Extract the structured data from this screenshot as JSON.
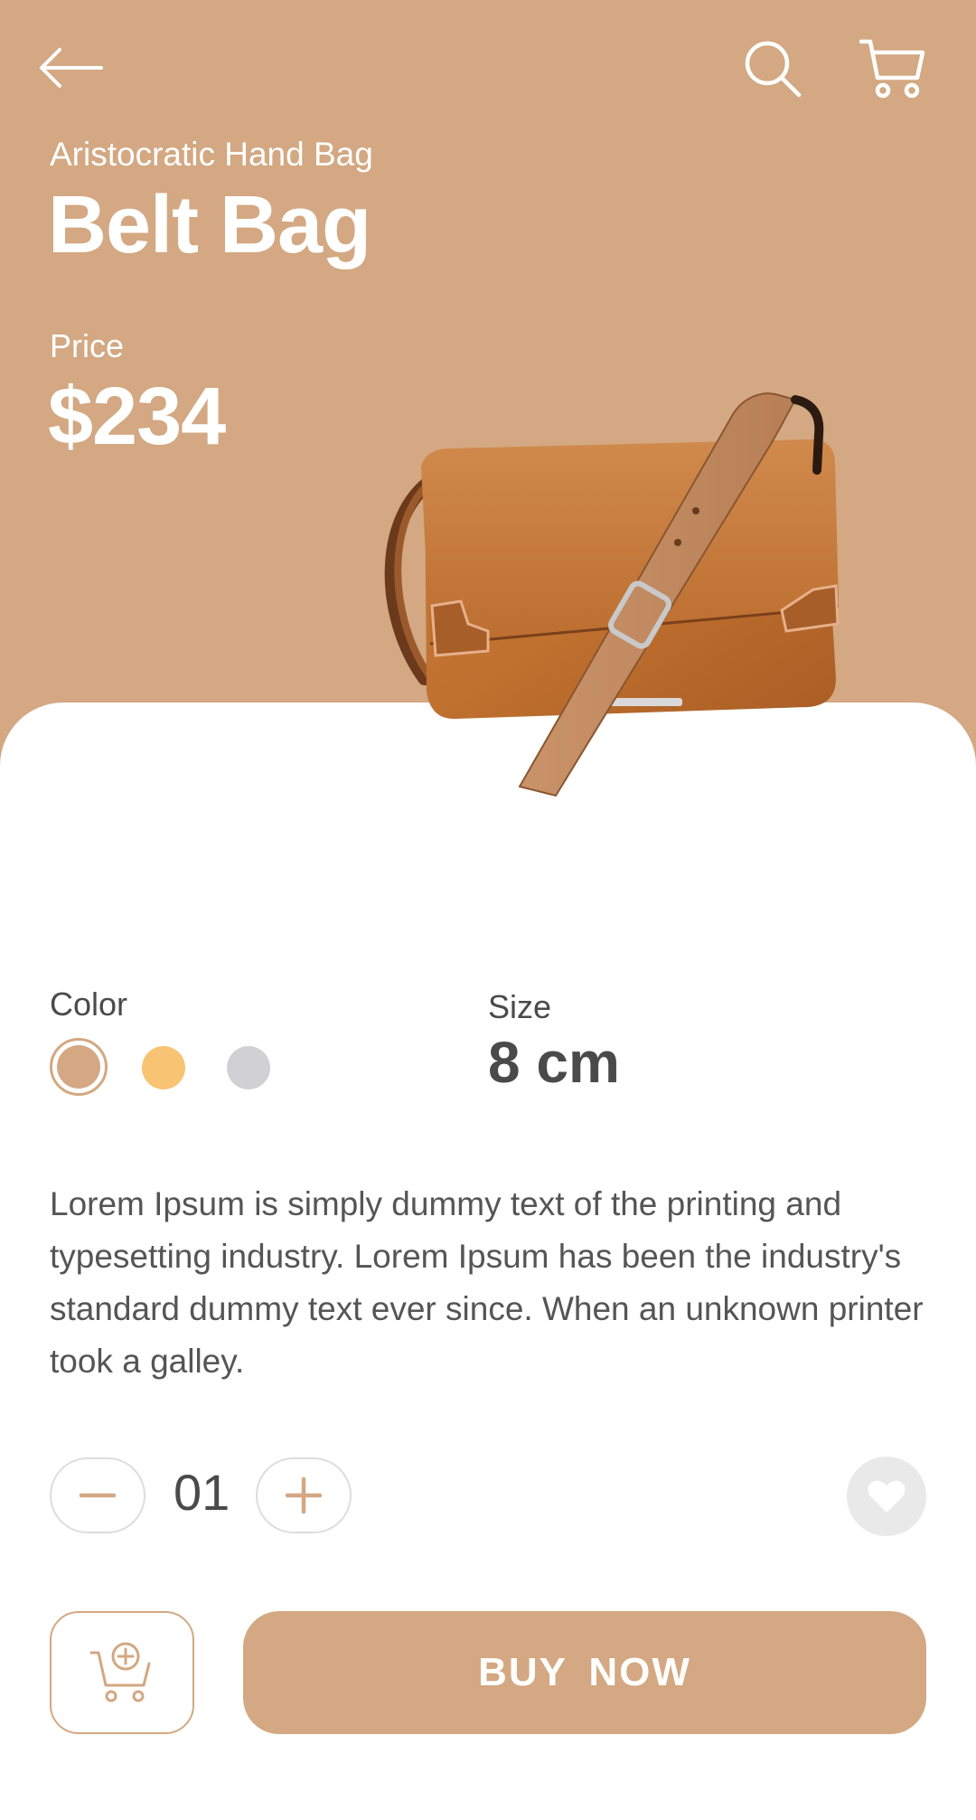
{
  "colors": {
    "hero_bg": "#D3A882",
    "accent": "#D3A882",
    "swatches": [
      "#D3A882",
      "#F8C373",
      "#D1D1D3"
    ]
  },
  "header": {
    "back_icon": "arrow-left-icon",
    "search_icon": "search-icon",
    "cart_icon": "cart-icon"
  },
  "product": {
    "subtitle": "Aristocratic Hand Bag",
    "name": "Belt Bag",
    "price_label": "Price",
    "price": "$234",
    "image": "brown-leather-shoulder-bag"
  },
  "options": {
    "color_label": "Color",
    "selected_color_index": 0,
    "size_label": "Size",
    "size_value": "8 cm"
  },
  "description": "Lorem Ipsum is simply dummy text of the printing and typesetting industry. Lorem Ipsum has been the industry's standard dummy text ever since. When an unknown printer took a galley.",
  "quantity": {
    "value": "01",
    "minus_icon": "minus-icon",
    "plus_icon": "plus-icon"
  },
  "actions": {
    "favorite_icon": "heart-icon",
    "add_to_cart_icon": "cart-plus-icon",
    "buy_label": "BUY  NOW"
  }
}
